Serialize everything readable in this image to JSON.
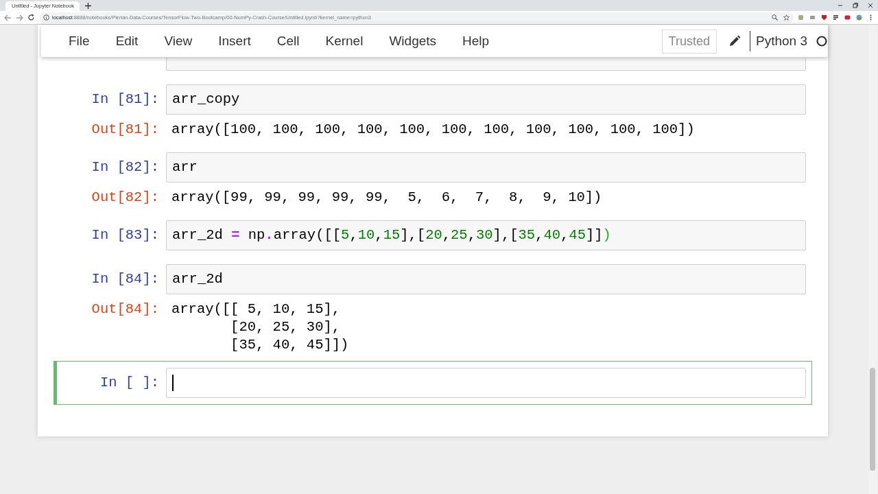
{
  "browser": {
    "tab_title": "Untitled - Jupyter Notebook",
    "url_host": "localhost",
    "url_path": ":8888/notebooks/Pierian-Data-Courses/TensorFlow-Two-Bootcamp/00-NumPy-Crash-Course/Untitled.ipynb?kernel_name=python3"
  },
  "menu": [
    "File",
    "Edit",
    "View",
    "Insert",
    "Cell",
    "Kernel",
    "Widgets",
    "Help"
  ],
  "toolbar": {
    "trusted": "Trusted",
    "kernel": "Python 3",
    "kernel_busy": false
  },
  "cells": [
    {
      "selected": false
    },
    {
      "prompt": "In [81]:",
      "selected": false,
      "code": [
        {
          "text": "arr_copy",
          "kind": "plain"
        }
      ],
      "output_prompt": "Out[81]:",
      "output": [
        "array([100, 100, 100, 100, 100, 100, 100, 100, 100, 100, 100])"
      ]
    },
    {
      "prompt": "In [82]:",
      "selected": false,
      "code": [
        {
          "text": "arr",
          "kind": "plain"
        }
      ],
      "output_prompt": "Out[82]:",
      "output": [
        "array([99, 99, 99, 99, 99,  5,  6,  7,  8,  9, 10])"
      ]
    },
    {
      "prompt": "In [83]:",
      "selected": false,
      "code": [
        {
          "text": "arr_2d ",
          "kind": "plain"
        },
        {
          "text": "=",
          "kind": "operator"
        },
        {
          "text": " np",
          "kind": "plain"
        },
        {
          "text": ".",
          "kind": "operator"
        },
        {
          "text": "array([[",
          "kind": "plain"
        },
        {
          "text": "5",
          "kind": "number"
        },
        {
          "text": ",",
          "kind": "plain"
        },
        {
          "text": "10",
          "kind": "number"
        },
        {
          "text": ",",
          "kind": "plain"
        },
        {
          "text": "15",
          "kind": "number"
        },
        {
          "text": "],[",
          "kind": "plain"
        },
        {
          "text": "20",
          "kind": "number"
        },
        {
          "text": ",",
          "kind": "plain"
        },
        {
          "text": "25",
          "kind": "number"
        },
        {
          "text": ",",
          "kind": "plain"
        },
        {
          "text": "30",
          "kind": "number"
        },
        {
          "text": "],[",
          "kind": "plain"
        },
        {
          "text": "35",
          "kind": "number"
        },
        {
          "text": ",",
          "kind": "plain"
        },
        {
          "text": "40",
          "kind": "number"
        },
        {
          "text": ",",
          "kind": "plain"
        },
        {
          "text": "45",
          "kind": "number"
        },
        {
          "text": "]]",
          "kind": "plain"
        },
        {
          "text": ")",
          "kind": "matched_bracket"
        }
      ]
    },
    {
      "prompt": "In [84]:",
      "selected": false,
      "code": [
        {
          "text": "arr_2d",
          "kind": "plain"
        }
      ],
      "output_prompt": "Out[84]:",
      "output": [
        "array([[ 5, 10, 15],",
        "       [20, 25, 30],",
        "       [35, 40, 45]])"
      ]
    },
    {
      "prompt": "In [ ]:",
      "selected": true
    }
  ]
}
